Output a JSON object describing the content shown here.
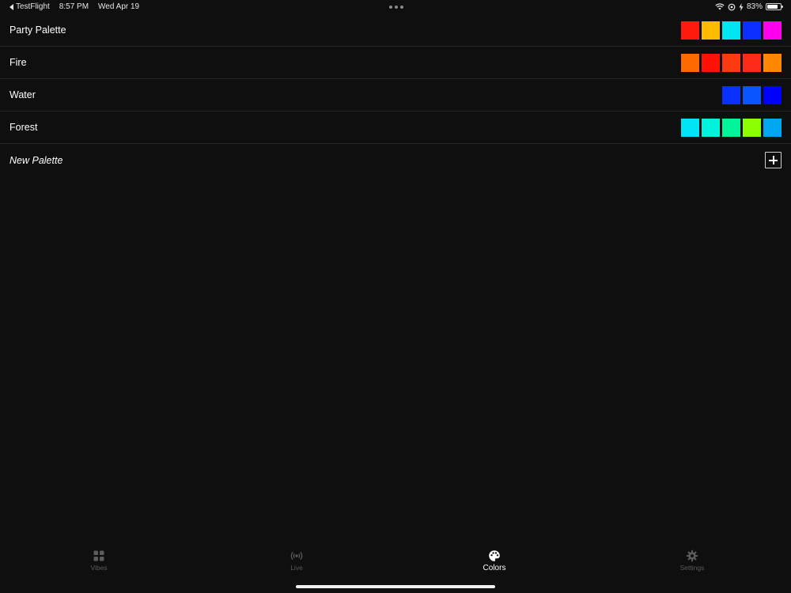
{
  "status_bar": {
    "back_app": "TestFlight",
    "time": "8:57 PM",
    "date": "Wed Apr 19",
    "battery_percent": "83%",
    "battery_level": 0.83
  },
  "palettes": [
    {
      "name": "Party Palette",
      "colors": [
        "#ff1a0d",
        "#ffbb00",
        "#00e5f2",
        "#0a2fff",
        "#ff00ee"
      ]
    },
    {
      "name": "Fire",
      "colors": [
        "#ff6a00",
        "#ff1105",
        "#ff3a10",
        "#ff2a1a",
        "#ff8800"
      ]
    },
    {
      "name": "Water",
      "colors": [
        "#0a30ff",
        "#0a55ff",
        "#0000ff"
      ]
    },
    {
      "name": "Forest",
      "colors": [
        "#00e5f5",
        "#00f2dd",
        "#00f59a",
        "#8cff00",
        "#00a6f0"
      ]
    }
  ],
  "new_palette": {
    "label": "New Palette"
  },
  "tabs": [
    {
      "label": "Vibes",
      "icon": "grid-icon",
      "active": false
    },
    {
      "label": "Live",
      "icon": "broadcast-icon",
      "active": false
    },
    {
      "label": "Colors",
      "icon": "palette-icon",
      "active": true
    },
    {
      "label": "Settings",
      "icon": "gear-icon",
      "active": false
    }
  ]
}
